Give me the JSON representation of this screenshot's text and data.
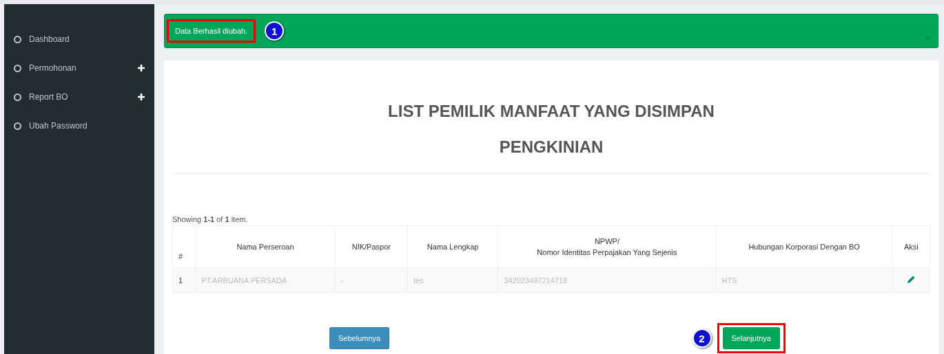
{
  "sidebar": {
    "items": [
      {
        "label": "Dashboard",
        "expandable": false
      },
      {
        "label": "Permohonan",
        "expandable": true
      },
      {
        "label": "Report BO",
        "expandable": true
      },
      {
        "label": "Ubah Password",
        "expandable": false
      }
    ]
  },
  "alert": {
    "message": "Data Berhasil diubah.",
    "highlighted": true,
    "step": "1",
    "close": "×"
  },
  "title": [
    "LIST PEMILIK MANFAAT YANG DISIMPAN",
    "PENGKINIAN"
  ],
  "summary": "Showing **1-1** of **1** item.",
  "table": {
    "columns": [
      "#",
      "Nama Perseroan",
      "NIK/Paspor",
      "Nama Lengkap",
      "NPWP/\nNomor Identitas Perpajakan Yang Sejenis",
      "Hubungan Korporasi Dengan BO",
      "Aksi"
    ],
    "rows": [
      {
        "cells": [
          "1",
          "PT.ARBUANA PERSADA",
          "-",
          "tes",
          "342023497214718",
          "HTS"
        ]
      }
    ]
  },
  "buttons": [
    {
      "label": "Sebelumnya",
      "kind": "prev",
      "highlighted": false
    },
    {
      "label": "Selanjutnya",
      "kind": "next",
      "highlighted": true,
      "step": "2"
    }
  ]
}
